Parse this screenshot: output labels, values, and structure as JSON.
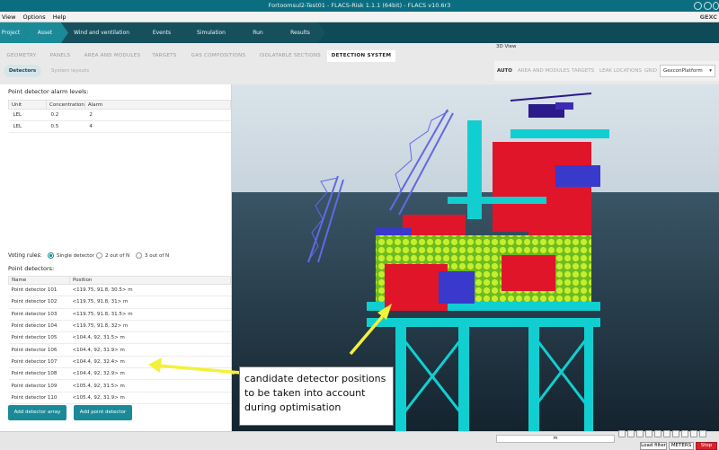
{
  "window": {
    "title": "Fortoomsul2-Test01 - FLACS-Risk 1.1.1 (64bit) - FLACS v10.6r3"
  },
  "menu": {
    "items": [
      "View",
      "Options",
      "Help"
    ],
    "brand": "GEXC"
  },
  "steps": [
    "Project",
    "Asset",
    "Wind and ventilation",
    "Events",
    "Simulation",
    "Run",
    "Results"
  ],
  "tabs": [
    "GEOMETRY",
    "PANELS",
    "AREA AND MODULES",
    "TARGETS",
    "GAS COMPOSITIONS",
    "ISOLATABLE SECTIONS",
    "DETECTION SYSTEM"
  ],
  "subtabs": [
    "Detectors",
    "System layouts"
  ],
  "view3d": {
    "label": "3D View",
    "items": [
      "AUTO",
      "AREA AND MODULES",
      "TARGETS",
      "LEAK LOCATIONS",
      "GRID"
    ],
    "select_value": "GexconPlatform"
  },
  "alarm": {
    "title": "Point detector alarm levels:",
    "headers": [
      "Unit",
      "Concentration",
      "Alarm"
    ],
    "rows": [
      [
        "LEL",
        "0.2",
        "2"
      ],
      [
        "LEL",
        "0.5",
        "4"
      ]
    ]
  },
  "voting": {
    "label": "Voting rules:",
    "options": [
      "Single detector",
      "2 out of N",
      "3 out of N"
    ]
  },
  "detectors": {
    "title": "Point detectors:",
    "headers": [
      "Name",
      "Position"
    ],
    "rows": [
      [
        "Point detector 101",
        "<119.75, 91.8, 30.5> m"
      ],
      [
        "Point detector 102",
        "<119.75, 91.8, 31> m"
      ],
      [
        "Point detector 103",
        "<119.75, 91.8, 31.5> m"
      ],
      [
        "Point detector 104",
        "<119.75, 91.8, 32> m"
      ],
      [
        "Point detector 105",
        "<104.4, 92, 31.5> m"
      ],
      [
        "Point detector 106",
        "<104.4, 92, 31.9> m"
      ],
      [
        "Point detector 107",
        "<104.4, 92, 32.4> m"
      ],
      [
        "Point detector 108",
        "<104.4, 92, 32.9> m"
      ],
      [
        "Point detector 109",
        "<105.4, 92, 31.5> m"
      ],
      [
        "Point detector 110",
        "<105.4, 92, 31.9> m"
      ]
    ]
  },
  "buttons": {
    "add_array": "Add detector array",
    "add_point": "Add point detector"
  },
  "callout": {
    "lines": [
      "candidate detector positions",
      "to be taken into account",
      "during optimisation"
    ]
  },
  "statusbar": {
    "unit": "m",
    "load_filter": "Load filter",
    "meters": "METERS",
    "stop": "Stop"
  },
  "colors": {
    "teal": "#1b8a98",
    "dark_teal": "#0f4a58",
    "arrow": "#f2f23a"
  }
}
